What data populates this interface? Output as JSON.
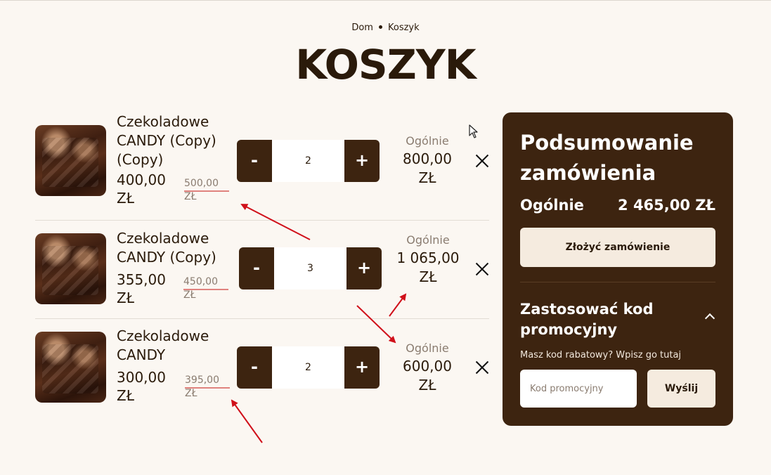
{
  "breadcrumb": {
    "home": "Dom",
    "current": "Koszyk"
  },
  "page_title": "KOSZYK",
  "cart_items": [
    {
      "name": "Czekoladowe CANDY (Copy) (Copy)",
      "price": "400,00 ZŁ",
      "old_price": "500,00 ZŁ",
      "quantity": "2",
      "minus": "-",
      "plus": "+",
      "total_label": "Ogólnie",
      "total": "800,00 ZŁ"
    },
    {
      "name": "Czekoladowe CANDY (Copy)",
      "price": "355,00 ZŁ",
      "old_price": "450,00 ZŁ",
      "quantity": "3",
      "minus": "-",
      "plus": "+",
      "total_label": "Ogólnie",
      "total": "1 065,00 ZŁ"
    },
    {
      "name": "Czekoladowe CANDY",
      "price": "300,00 ZŁ",
      "old_price": "395,00 ZŁ",
      "quantity": "2",
      "minus": "-",
      "plus": "+",
      "total_label": "Ogólnie",
      "total": "600,00 ZŁ"
    }
  ],
  "summary": {
    "title": "Podsumowanie zamówienia",
    "total_label": "Ogólnie",
    "total_value": "2 465,00 ZŁ",
    "order_button": "Złożyć zamówienie",
    "promo_title": "Zastosować kod promocyjny",
    "promo_hint": "Masz kod rabatowy? Wpisz go tutaj",
    "promo_placeholder": "Kod promocyjny",
    "send_button": "Wyślij"
  },
  "icons": {
    "remove": "close-icon",
    "collapse": "chevron-up-icon",
    "cursor": "mouse-pointer-icon",
    "annotation_color": "#d0101a"
  },
  "colors": {
    "background": "#fbf7f2",
    "dark_brown": "#3d2410",
    "light_button": "#f5ebdf",
    "old_price_strike": "#e0827e"
  }
}
